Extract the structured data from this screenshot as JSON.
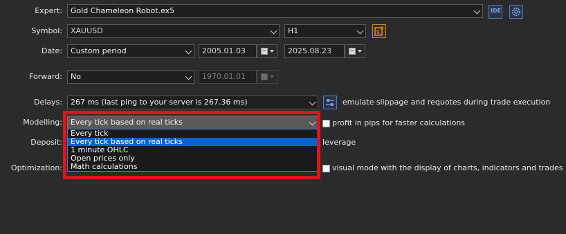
{
  "expert": {
    "label": "Expert:",
    "value": "Gold Chameleon Robot.ex5",
    "ide_button": "IDE",
    "settings_icon": "gear-icon"
  },
  "symbol": {
    "label": "Symbol:",
    "value": "XAUUSD",
    "timeframe": "H1",
    "spec_icon": "symbol-properties-icon"
  },
  "date": {
    "label": "Date:",
    "period": "Custom period",
    "from": "2005.01.03",
    "to": "2025.08.23"
  },
  "forward": {
    "label": "Forward:",
    "value": "No",
    "date": "1970.01.01"
  },
  "delays": {
    "label": "Delays:",
    "value": "267 ms (last ping to your server is 267.36 ms)",
    "note": "emulate slippage and requotes during trade execution"
  },
  "modelling": {
    "label": "Modelling:",
    "value": "Every tick based on real ticks",
    "options": [
      "Every tick",
      "Every tick based on real ticks",
      "1 minute OHLC",
      "Open prices only",
      "Math calculations"
    ],
    "selected_index": 1,
    "pips_checkbox": "profit in pips for faster calculations"
  },
  "deposit": {
    "label": "Deposit:",
    "leverage_text": "leverage"
  },
  "optimization": {
    "label": "Optimization:",
    "visual_checkbox": "visual mode with the display of charts, indicators and trades"
  },
  "colors": {
    "background": "#2b2b2b",
    "highlight_box": "#e0141e",
    "selected_option": "#0a63cf"
  }
}
